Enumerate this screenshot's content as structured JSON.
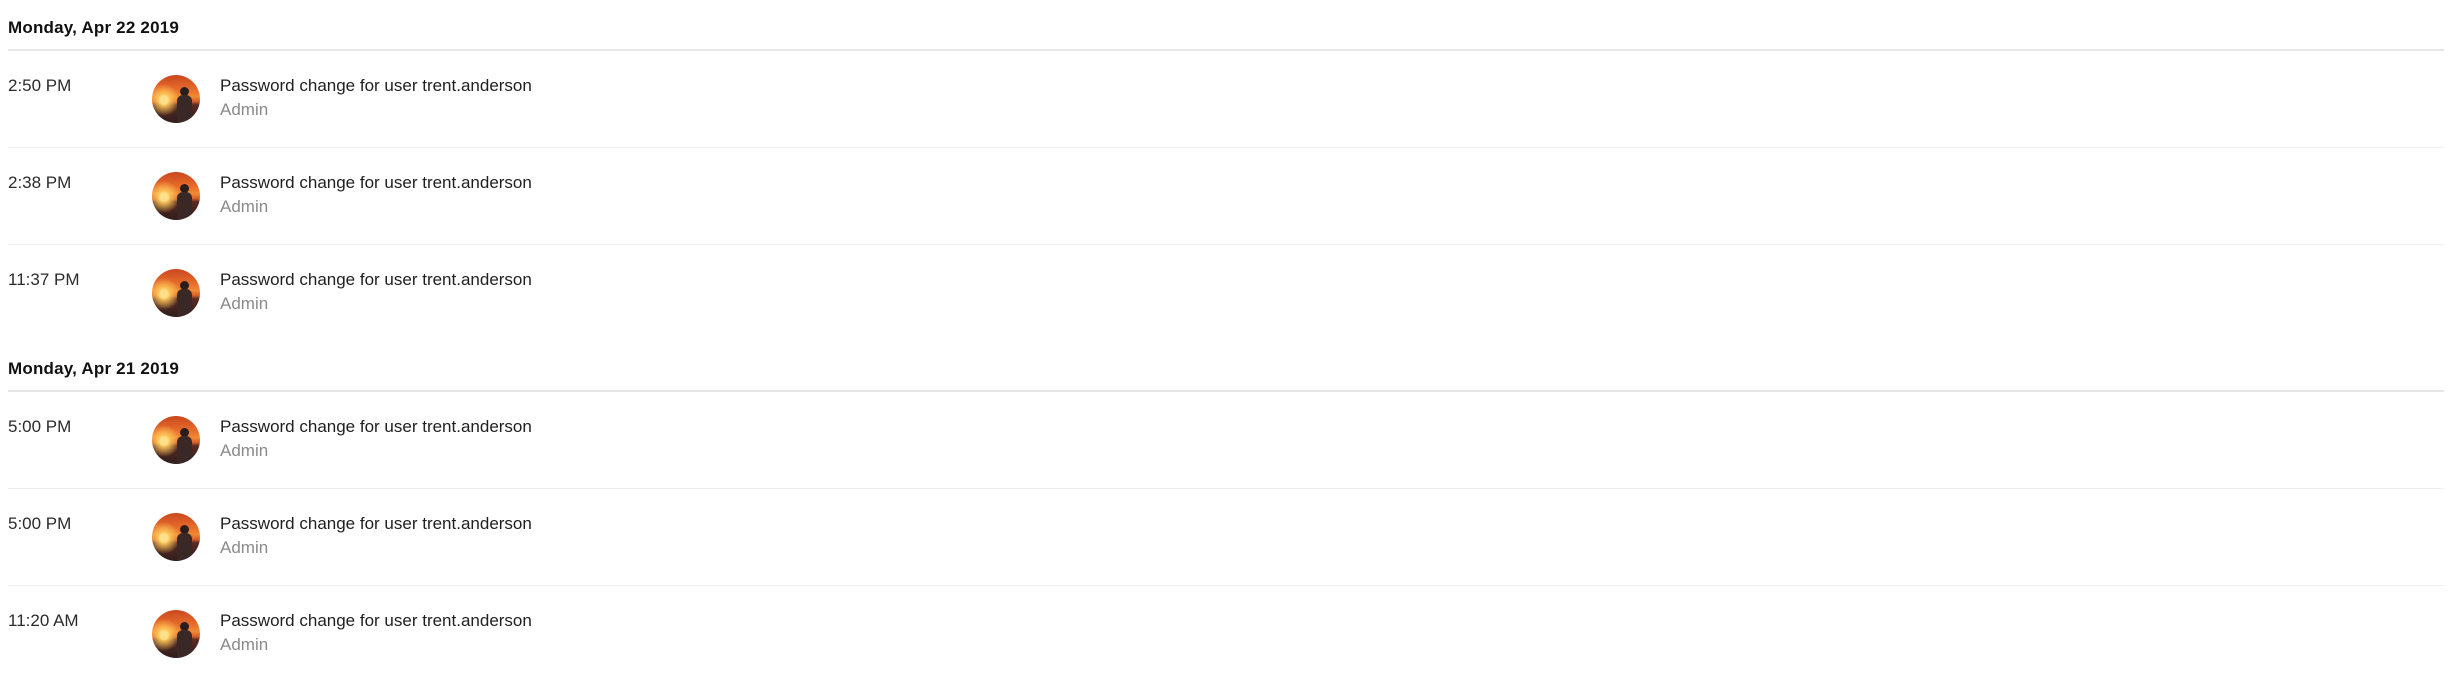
{
  "groups": [
    {
      "date": "Monday, Apr 22 2019",
      "entries": [
        {
          "time": "2:50 PM",
          "message": "Password change for user trent.anderson",
          "actor": "Admin"
        },
        {
          "time": "2:38 PM",
          "message": "Password change for user trent.anderson",
          "actor": "Admin"
        },
        {
          "time": "11:37 PM",
          "message": "Password change for user trent.anderson",
          "actor": "Admin"
        }
      ]
    },
    {
      "date": "Monday, Apr 21 2019",
      "entries": [
        {
          "time": "5:00 PM",
          "message": "Password change for user trent.anderson",
          "actor": "Admin"
        },
        {
          "time": "5:00 PM",
          "message": "Password change for user trent.anderson",
          "actor": "Admin"
        },
        {
          "time": "11:20 AM",
          "message": "Password change for user trent.anderson",
          "actor": "Admin"
        }
      ]
    }
  ],
  "avatar": {
    "icon": "user-avatar-sunset-photo",
    "colors": {
      "sky": "#e56a2a",
      "sun": "#ffe08a",
      "ground": "#2e1d1c"
    }
  }
}
